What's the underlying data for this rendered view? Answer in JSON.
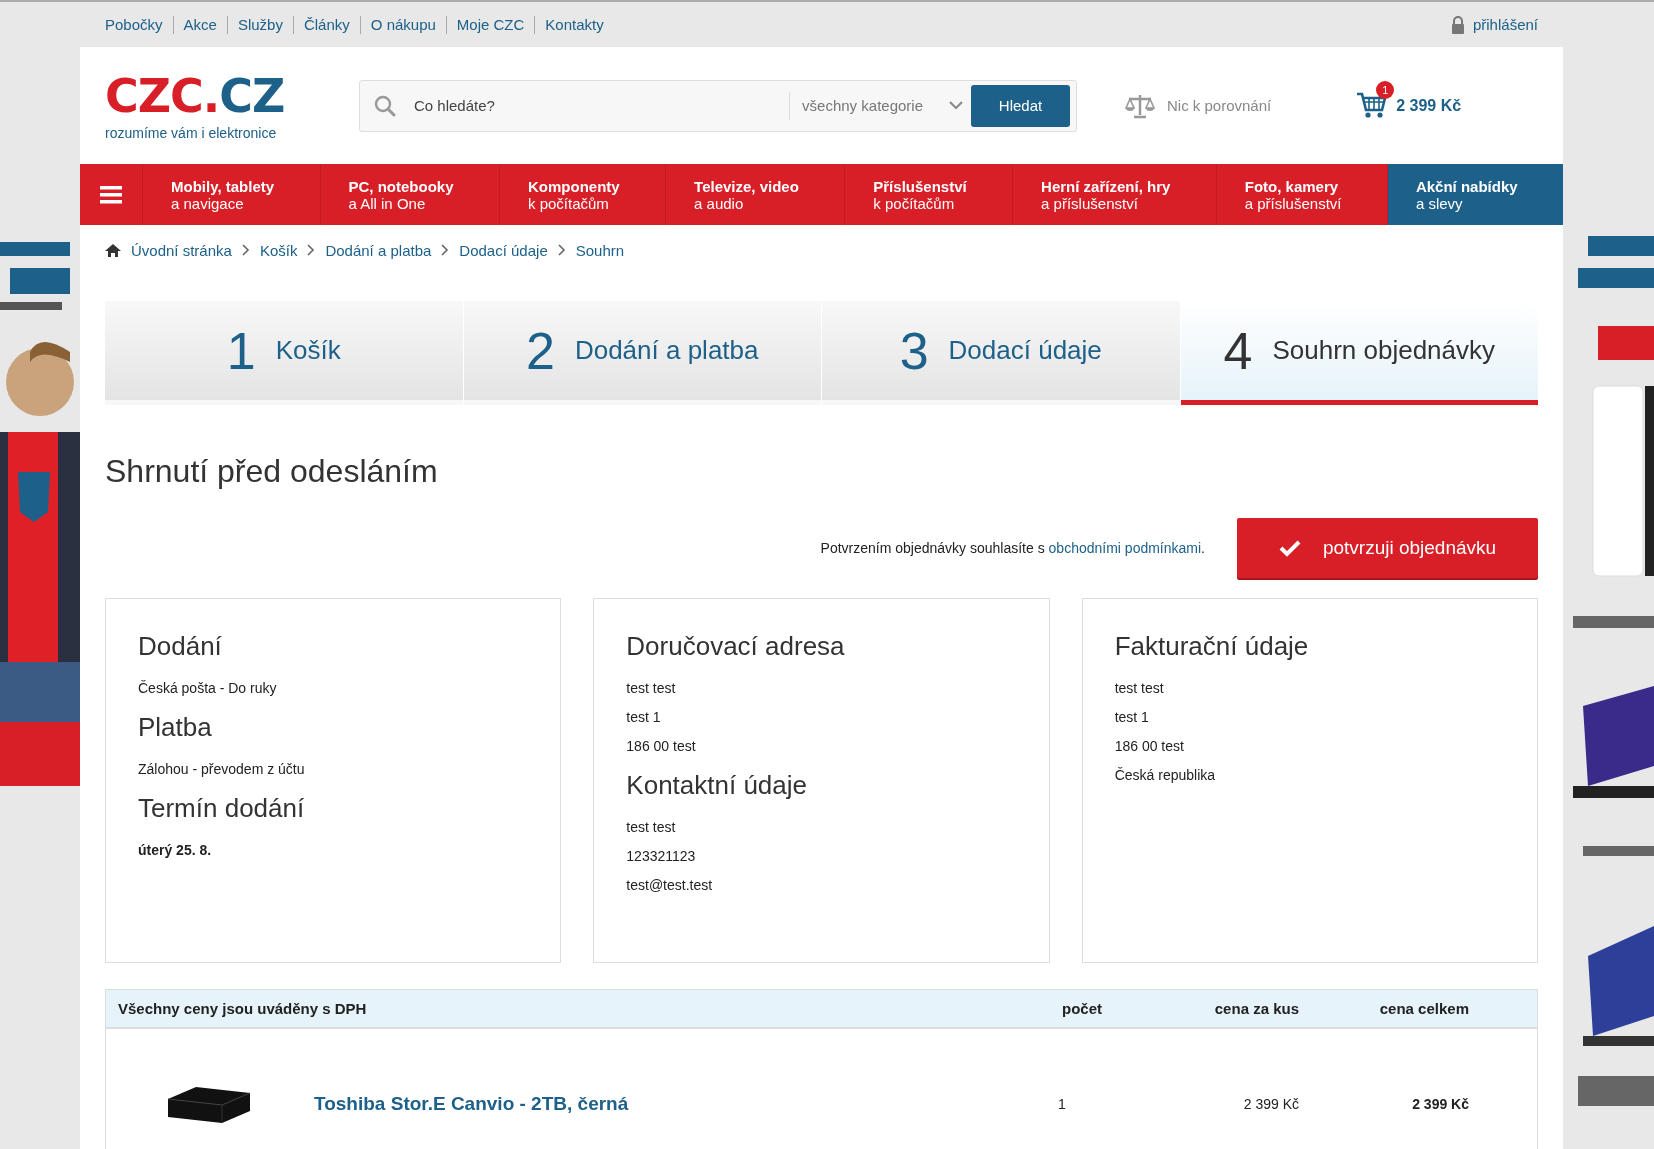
{
  "top_links": [
    "Pobočky",
    "Akce",
    "Služby",
    "Články",
    "O nákupu",
    "Moje CZC",
    "Kontakty"
  ],
  "login": "přihlášení",
  "logo": {
    "part1": "CZC.",
    "part2": "CZ",
    "tagline": "rozumíme vám i elektronice"
  },
  "search": {
    "placeholder": "Co hledáte?",
    "category": "všechny kategorie",
    "button": "Hledat"
  },
  "compare": "Nic k porovnání",
  "cart": {
    "count": "1",
    "total": "2 399 Kč"
  },
  "nav": [
    {
      "title": "Mobily, tablety",
      "subtitle": "a navigace",
      "highlight": false
    },
    {
      "title": "PC, notebooky",
      "subtitle": "a All in One",
      "highlight": false
    },
    {
      "title": "Komponenty",
      "subtitle": "k počítačům",
      "highlight": false
    },
    {
      "title": "Televize, video",
      "subtitle": "a audio",
      "highlight": false
    },
    {
      "title": "Příslušenství",
      "subtitle": "k počítačům",
      "highlight": false
    },
    {
      "title": "Herní zařízení, hry",
      "subtitle": "a příslušenství",
      "highlight": false
    },
    {
      "title": "Foto, kamery",
      "subtitle": "a příslušenství",
      "highlight": false
    },
    {
      "title": "Akční nabídky",
      "subtitle": "a slevy",
      "highlight": true
    }
  ],
  "breadcrumb": [
    "Úvodní stránka",
    "Košík",
    "Dodání a platba",
    "Dodací údaje",
    "Souhrn"
  ],
  "steps": [
    {
      "number": "1",
      "label": "Košík",
      "selected": false
    },
    {
      "number": "2",
      "label": "Dodání a platba",
      "selected": false
    },
    {
      "number": "3",
      "label": "Dodací údaje",
      "selected": false
    },
    {
      "number": "4",
      "label": "Souhrn objednávky",
      "selected": true
    }
  ],
  "page_title": "Shrnutí před odesláním",
  "confirm": {
    "text_before": "Potvrzením objednávky souhlasíte s ",
    "link": "obchodními podmínkami",
    "text_after": ".",
    "button": "potvrzuji objednávku"
  },
  "cards": [
    {
      "sections": [
        {
          "heading": "Dodání",
          "lines": [
            {
              "text": "Česká pošta - Do ruky",
              "bold": false
            }
          ]
        },
        {
          "heading": "Platba",
          "lines": [
            {
              "text": "Zálohou - převodem z účtu",
              "bold": false
            }
          ]
        },
        {
          "heading": "Termín dodání",
          "lines": [
            {
              "text": "úterý 25. 8.",
              "bold": true
            }
          ]
        }
      ]
    },
    {
      "sections": [
        {
          "heading": "Doručovací adresa",
          "lines": [
            {
              "text": "test test",
              "bold": false
            },
            {
              "text": "test 1",
              "bold": false
            },
            {
              "text": "186 00 test",
              "bold": false
            }
          ]
        },
        {
          "heading": "Kontaktní údaje",
          "lines": [
            {
              "text": "test test",
              "bold": false
            },
            {
              "text": "123321123",
              "bold": false
            },
            {
              "text": "test@test.test",
              "bold": false
            }
          ]
        }
      ]
    },
    {
      "sections": [
        {
          "heading": "Fakturační údaje",
          "lines": [
            {
              "text": "test test",
              "bold": false
            },
            {
              "text": "test 1",
              "bold": false
            },
            {
              "text": "186 00 test",
              "bold": false
            },
            {
              "text": "Česká republika",
              "bold": false
            }
          ]
        }
      ]
    }
  ],
  "table": {
    "columns": [
      "Všechny ceny jsou uváděny s DPH",
      "počet",
      "cena za kus",
      "cena celkem"
    ],
    "rows": [
      {
        "name": "Toshiba Stor.E Canvio - 2TB, černá",
        "count": "1",
        "unit_price": "2 399 Kč",
        "total": "2 399 Kč"
      }
    ]
  },
  "ads": [
    {
      "kind": "picture"
    },
    {
      "kind": "picture"
    }
  ]
}
